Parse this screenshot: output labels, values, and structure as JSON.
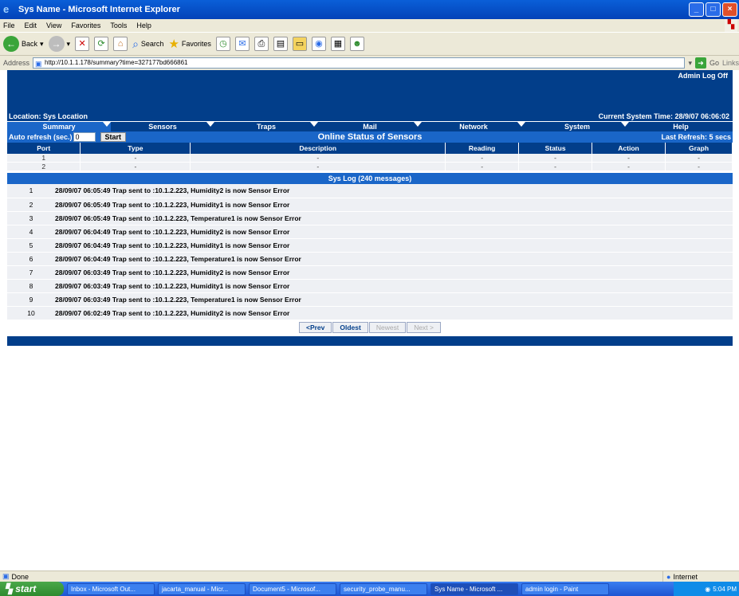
{
  "window": {
    "title": "Sys Name - Microsoft Internet Explorer"
  },
  "menu": [
    "File",
    "Edit",
    "View",
    "Favorites",
    "Tools",
    "Help"
  ],
  "toolbar": {
    "back": "Back",
    "search": "Search",
    "favorites": "Favorites"
  },
  "address": {
    "label": "Address",
    "url": "http://10.1.1.178/summary?time=327177bd666861",
    "go": "Go",
    "links": "Links"
  },
  "header": {
    "admin": "Admin",
    "logoff": "Log Off",
    "location": "Location: Sys Location",
    "time": "Current System Time: 28/9/07 06:06:02"
  },
  "tabs": [
    "Summary",
    "Sensors",
    "Traps",
    "Mail",
    "Network",
    "System",
    "Help"
  ],
  "status": {
    "auto_label": "Auto refresh (sec.)",
    "auto_value": "0",
    "start": "Start",
    "title": "Online Status of Sensors",
    "last_refresh": "Last Refresh: 5 secs"
  },
  "sensor_table": {
    "headers": [
      "Port",
      "Type",
      "Description",
      "Reading",
      "Status",
      "Action",
      "Graph"
    ],
    "rows": [
      [
        "1",
        "-",
        "-",
        "-",
        "-",
        "-",
        "-"
      ],
      [
        "2",
        "-",
        "-",
        "-",
        "-",
        "-",
        "-"
      ]
    ]
  },
  "syslog": {
    "title": "Sys Log (240 messages)",
    "entries": [
      {
        "n": "1",
        "msg": "28/09/07 06:05:49 Trap sent to :10.1.2.223, Humidity2 is now Sensor Error"
      },
      {
        "n": "2",
        "msg": "28/09/07 06:05:49 Trap sent to :10.1.2.223, Humidity1 is now Sensor Error"
      },
      {
        "n": "3",
        "msg": "28/09/07 06:05:49 Trap sent to :10.1.2.223, Temperature1 is now Sensor Error"
      },
      {
        "n": "4",
        "msg": "28/09/07 06:04:49 Trap sent to :10.1.2.223, Humidity2 is now Sensor Error"
      },
      {
        "n": "5",
        "msg": "28/09/07 06:04:49 Trap sent to :10.1.2.223, Humidity1 is now Sensor Error"
      },
      {
        "n": "6",
        "msg": "28/09/07 06:04:49 Trap sent to :10.1.2.223, Temperature1 is now Sensor Error"
      },
      {
        "n": "7",
        "msg": "28/09/07 06:03:49 Trap sent to :10.1.2.223, Humidity2 is now Sensor Error"
      },
      {
        "n": "8",
        "msg": "28/09/07 06:03:49 Trap sent to :10.1.2.223, Humidity1 is now Sensor Error"
      },
      {
        "n": "9",
        "msg": "28/09/07 06:03:49 Trap sent to :10.1.2.223, Temperature1 is now Sensor Error"
      },
      {
        "n": "10",
        "msg": "28/09/07 06:02:49 Trap sent to :10.1.2.223, Humidity2 is now Sensor Error"
      }
    ]
  },
  "pager": {
    "prev": "<Prev",
    "oldest": "Oldest",
    "newest": "Newest",
    "next": "Next >"
  },
  "ie_status": {
    "left": "Done",
    "zone": "Internet"
  },
  "taskbar": {
    "start": "start",
    "tasks": [
      "Inbox - Microsoft Out...",
      "jacarta_manual - Micr...",
      "Document5 - Microsof...",
      "security_probe_manu...",
      "Sys Name - Microsoft ...",
      "admin login - Paint"
    ],
    "clock": "5:04 PM"
  }
}
